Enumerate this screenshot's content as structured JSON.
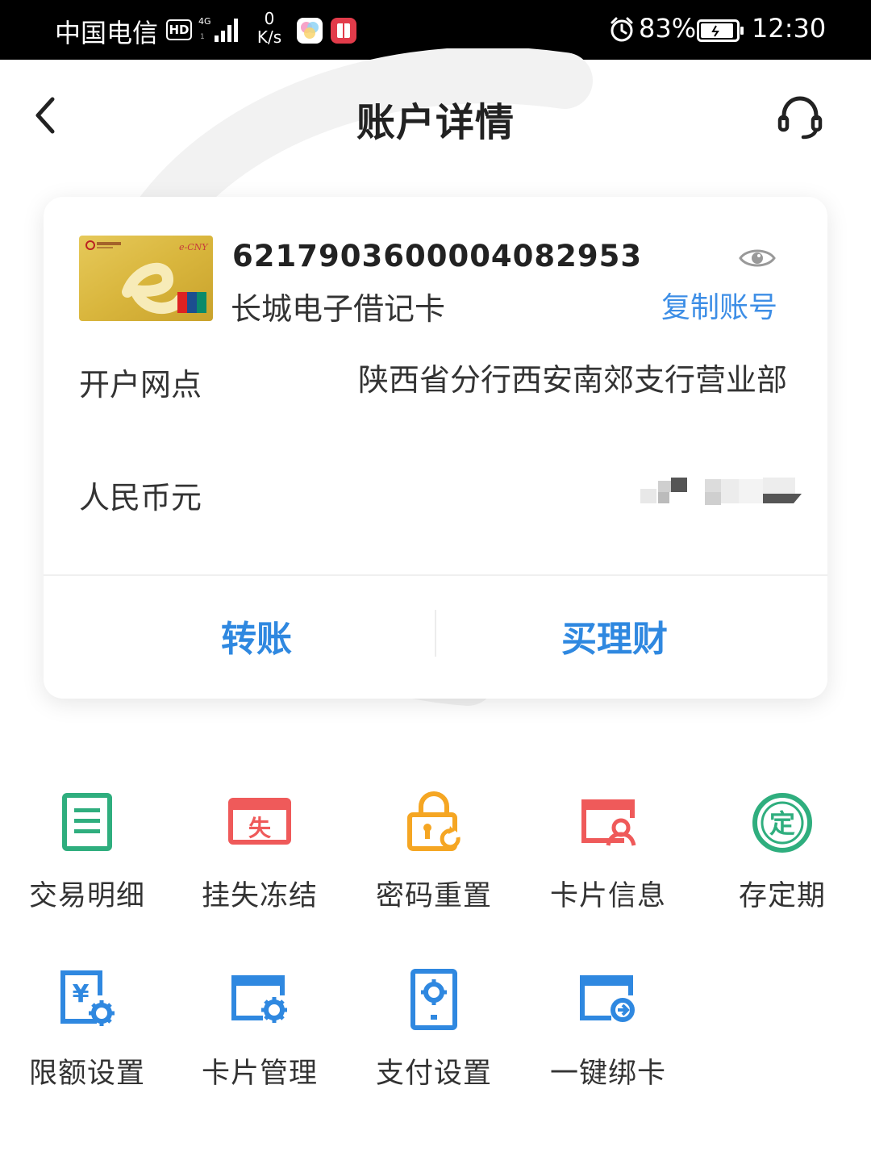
{
  "status_bar": {
    "carrier": "中国电信",
    "hd_badge": "HD",
    "network": "4G",
    "net_speed_value": "0",
    "net_speed_unit": "K/s",
    "battery_percent": "83%",
    "time": "12:30"
  },
  "header": {
    "title": "账户详情",
    "back_icon": "chevron-left-icon",
    "service_icon": "headset-icon"
  },
  "account": {
    "card_number": "6217903600004082953",
    "card_type": "长城电子借记卡",
    "copy_label": "复制账号",
    "branch_label": "开户网点",
    "branch_value": "陕西省分行西安南郊支行营业部",
    "currency_label": "人民币元",
    "balance_masked": true
  },
  "card_actions": [
    {
      "label": "转账"
    },
    {
      "label": "买理财"
    }
  ],
  "services": [
    {
      "label": "交易明细",
      "icon": "document-list-icon",
      "color": "#2fae7e"
    },
    {
      "label": "挂失冻结",
      "icon": "report-loss-icon",
      "color": "#ef5a5a"
    },
    {
      "label": "密码重置",
      "icon": "lock-reset-icon",
      "color": "#f5a623"
    },
    {
      "label": "卡片信息",
      "icon": "card-user-icon",
      "color": "#ef5a5a"
    },
    {
      "label": "存定期",
      "icon": "fixed-deposit-icon",
      "color": "#2fae7e"
    },
    {
      "label": "限额设置",
      "icon": "limit-settings-icon",
      "color": "#2f88e0"
    },
    {
      "label": "卡片管理",
      "icon": "card-settings-icon",
      "color": "#2f88e0"
    },
    {
      "label": "支付设置",
      "icon": "payment-settings-icon",
      "color": "#2f88e0"
    },
    {
      "label": "一键绑卡",
      "icon": "bind-card-icon",
      "color": "#2f88e0"
    }
  ],
  "colors": {
    "accent_blue": "#2f88e0",
    "link_blue": "#3d8ee6",
    "green": "#2fae7e",
    "red": "#ef5a5a",
    "orange": "#f5a623"
  }
}
